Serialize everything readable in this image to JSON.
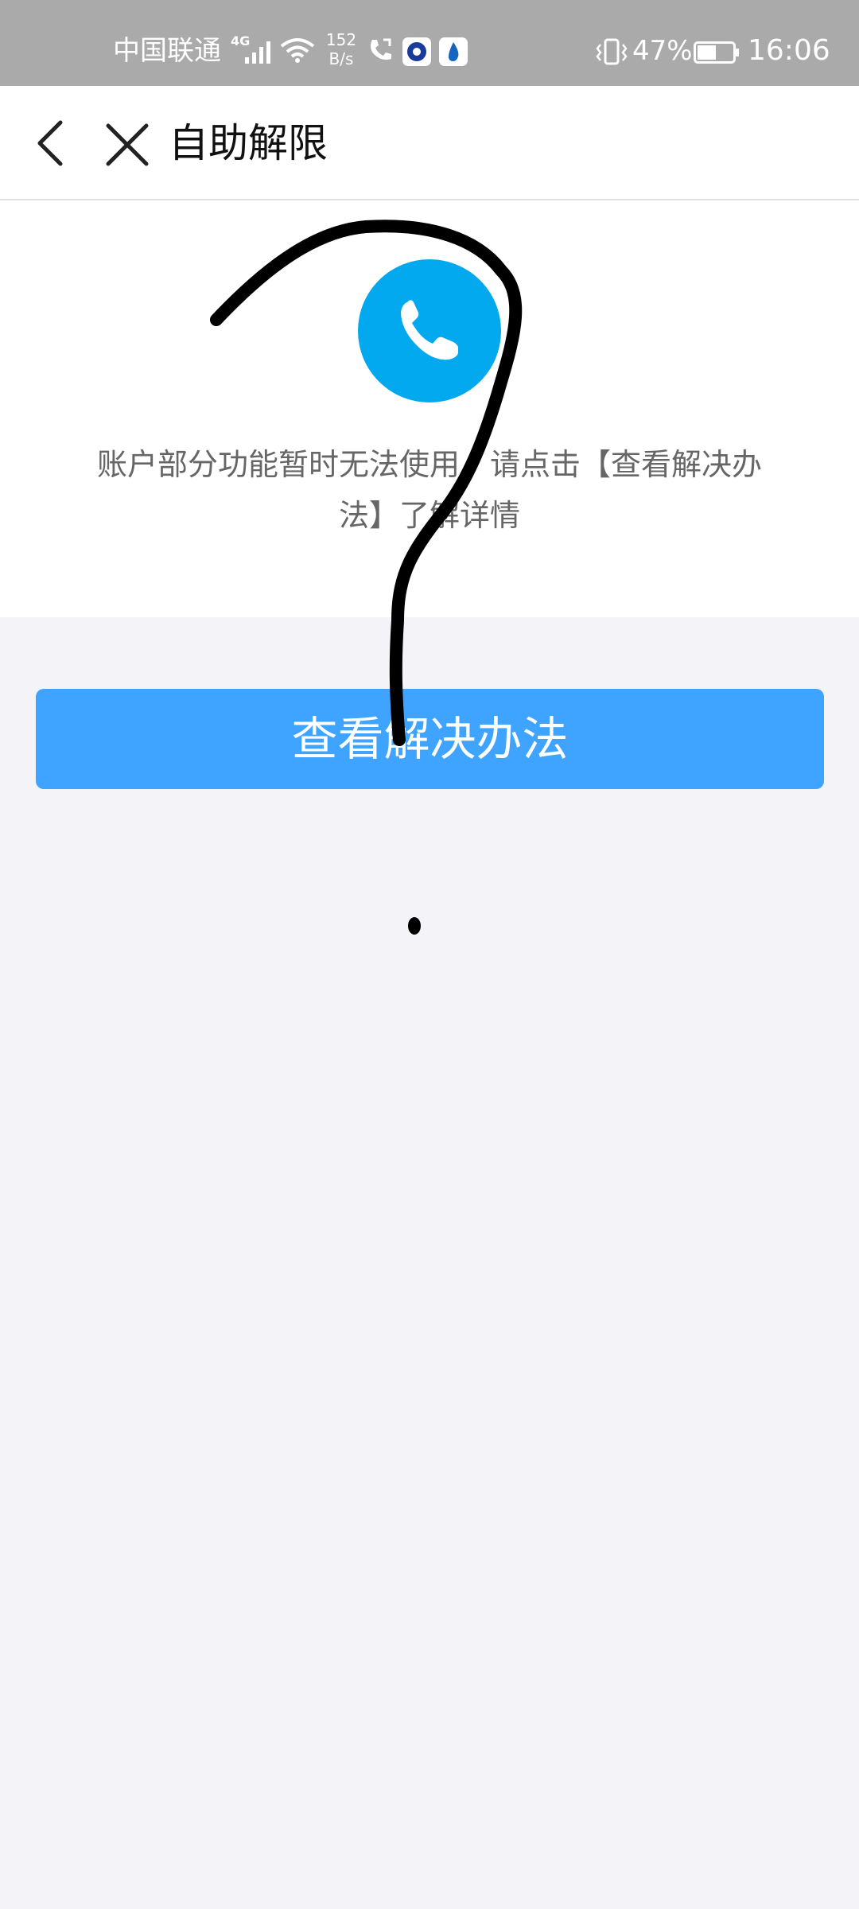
{
  "status_bar": {
    "carrier": "中国联通",
    "network": "4G",
    "speed_value": "152",
    "speed_unit": "B/s",
    "battery_percent": "47%",
    "time": "16:06"
  },
  "nav": {
    "title": "自助解限"
  },
  "info": {
    "message": "账户部分功能暂时无法使用，请点击【查看解决办法】了解详情"
  },
  "button": {
    "label": "查看解决办法"
  },
  "colors": {
    "status_bar": "#aaaaaa",
    "icon_circle": "#03a9ee",
    "button": "#3fa4ff",
    "background": "#f3f3f8"
  }
}
